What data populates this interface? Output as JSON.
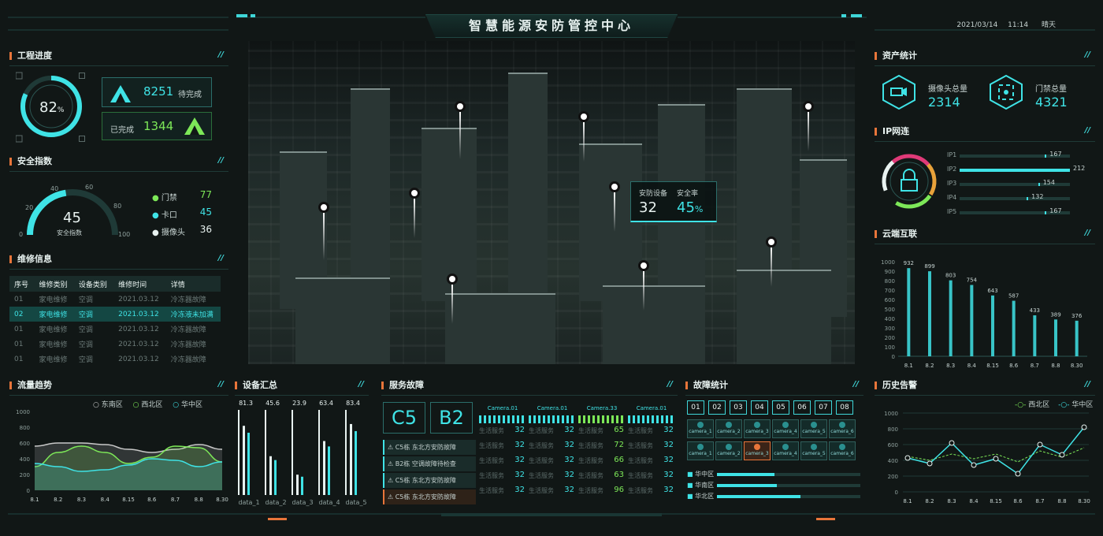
{
  "header": {
    "title": "智慧能源安防管控中心",
    "date": "2021/03/14",
    "time": "11:14",
    "weather": "晴天"
  },
  "project": {
    "title": "工程进度",
    "percent": "82",
    "percent_unit": "%",
    "percent_value": 82,
    "pending_value": "8251",
    "pending_label": "待完成",
    "done_label": "已完成",
    "done_value": "1344"
  },
  "safety": {
    "title": "安全指数",
    "value": "45",
    "label": "安全指数",
    "gauge_value": 45,
    "ticks": [
      "0",
      "20",
      "40",
      "60",
      "80",
      "100"
    ],
    "legend": [
      {
        "label": "门禁",
        "value": "77",
        "color": "#7de858"
      },
      {
        "label": "卡口",
        "value": "45",
        "color": "#3fe3e6"
      },
      {
        "label": "摄像头",
        "value": "36",
        "color": "#e8f2f0"
      }
    ]
  },
  "repair": {
    "title": "维修信息",
    "headers": [
      "序号",
      "维修类别",
      "设备类别",
      "维修时间",
      "详情"
    ],
    "rows": [
      [
        "01",
        "家电维修",
        "空调",
        "2021.03.12",
        "冷冻器故障"
      ],
      [
        "02",
        "家电维修",
        "空调",
        "2021.03.12",
        "冷冻液未加满"
      ],
      [
        "01",
        "家电维修",
        "空调",
        "2021.03.12",
        "冷冻器故障"
      ],
      [
        "01",
        "家电维修",
        "空调",
        "2021.03.12",
        "冷冻器故障"
      ],
      [
        "01",
        "家电维修",
        "空调",
        "2021.03.12",
        "冷冻器故障"
      ]
    ]
  },
  "overlay": {
    "device_label": "安防设备",
    "device_value": "32",
    "rate_label": "安全率",
    "rate_value": "45",
    "rate_unit": "%"
  },
  "assets": {
    "title": "资产统计",
    "camera_label": "摄像头总量",
    "camera_value": "2314",
    "door_label": "门禁总量",
    "door_value": "4321"
  },
  "ip": {
    "title": "IP网连",
    "items": [
      {
        "label": "IP1",
        "value": "167"
      },
      {
        "label": "IP2",
        "value": "212"
      },
      {
        "label": "IP3",
        "value": "154"
      },
      {
        "label": "IP4",
        "value": "132"
      },
      {
        "label": "IP5",
        "value": "167"
      }
    ]
  },
  "cloud": {
    "title": "云端互联"
  },
  "flow": {
    "title": "流量趋势",
    "legend": [
      "东南区",
      "西北区",
      "华中区"
    ]
  },
  "devices": {
    "title": "设备汇总"
  },
  "service": {
    "title": "服务故障",
    "code1": "C5",
    "code2": "B2",
    "alerts": [
      "C5栋 东北方安防故障",
      "B2栋 空调故障待检查",
      "C5栋 东北方安防故障",
      "C5栋 东北方安防故障"
    ],
    "cameras": [
      "Camera.01",
      "Camera.01",
      "Camera.33",
      "Camera.01"
    ],
    "grid_label": "生活服务",
    "values": [
      [
        "32",
        "32",
        "65",
        "32"
      ],
      [
        "32",
        "32",
        "72",
        "32"
      ],
      [
        "32",
        "32",
        "66",
        "32"
      ],
      [
        "32",
        "32",
        "63",
        "32"
      ],
      [
        "32",
        "32",
        "96",
        "32"
      ]
    ]
  },
  "fault": {
    "title": "故障统计",
    "tabs": [
      "01",
      "02",
      "03",
      "04",
      "05",
      "06",
      "07",
      "08"
    ],
    "cams": [
      "camera_1",
      "camera_2",
      "camera_3",
      "camera_4",
      "camera_5",
      "camera_6"
    ],
    "regions": [
      {
        "label": "华中区",
        "value": 0.4
      },
      {
        "label": "华南区",
        "value": 0.42
      },
      {
        "label": "华北区",
        "value": 0.58
      }
    ]
  },
  "history": {
    "title": "历史告警",
    "legend": [
      "西北区",
      "华中区"
    ]
  },
  "chart_data": [
    {
      "type": "bar",
      "title": "云端互联",
      "categories": [
        "8.1",
        "8.2",
        "8.3",
        "8.4",
        "8.15",
        "8.6",
        "8.7",
        "8.8",
        "8.30"
      ],
      "values": [
        932,
        899,
        803,
        754,
        643,
        587,
        433,
        389,
        376
      ],
      "ylim": [
        0,
        1000
      ],
      "yticks": [
        "0",
        "100",
        "200",
        "300",
        "400",
        "500",
        "600",
        "700",
        "800",
        "900",
        "1000"
      ]
    },
    {
      "type": "area",
      "title": "流量趋势",
      "categories": [
        "8.1",
        "8.2",
        "8.3",
        "8.4",
        "8.15",
        "8.6",
        "8.7",
        "8.8",
        "8.30"
      ],
      "ylim": [
        0,
        1000
      ],
      "yticks": [
        "0",
        "200",
        "400",
        "600",
        "800",
        "1000"
      ],
      "series": [
        {
          "name": "东南区",
          "color": "#c8c8c8",
          "values": [
            560,
            600,
            600,
            580,
            520,
            480,
            520,
            580,
            520
          ]
        },
        {
          "name": "西北区",
          "color": "#7de858",
          "values": [
            300,
            480,
            560,
            480,
            340,
            420,
            560,
            540,
            360
          ]
        },
        {
          "name": "华中区",
          "color": "#3fe3e6",
          "values": [
            340,
            300,
            240,
            260,
            320,
            400,
            380,
            300,
            360
          ]
        }
      ]
    },
    {
      "type": "bar",
      "title": "设备汇总",
      "categories": [
        "data_1",
        "data_2",
        "data_3",
        "data_4",
        "data_5"
      ],
      "values": [
        81.3,
        45.6,
        23.9,
        63.4,
        83.4
      ],
      "labels": [
        "81.3",
        "45.6",
        "23.9",
        "63.4",
        "83.4"
      ]
    },
    {
      "type": "line",
      "title": "历史告警",
      "categories": [
        "8.1",
        "8.2",
        "8.3",
        "8.4",
        "8.15",
        "8.6",
        "8.7",
        "8.8",
        "8.30"
      ],
      "ylim": [
        0,
        1000
      ],
      "yticks": [
        "0",
        "200",
        "400",
        "600",
        "800",
        "1000"
      ],
      "series": [
        {
          "name": "西北区",
          "color": "#7de858",
          "values": [
            450,
            400,
            480,
            420,
            480,
            380,
            520,
            440,
            560
          ]
        },
        {
          "name": "华中区",
          "color": "#3fe3e6",
          "values": [
            430,
            360,
            620,
            340,
            420,
            230,
            600,
            470,
            820
          ]
        }
      ]
    }
  ]
}
